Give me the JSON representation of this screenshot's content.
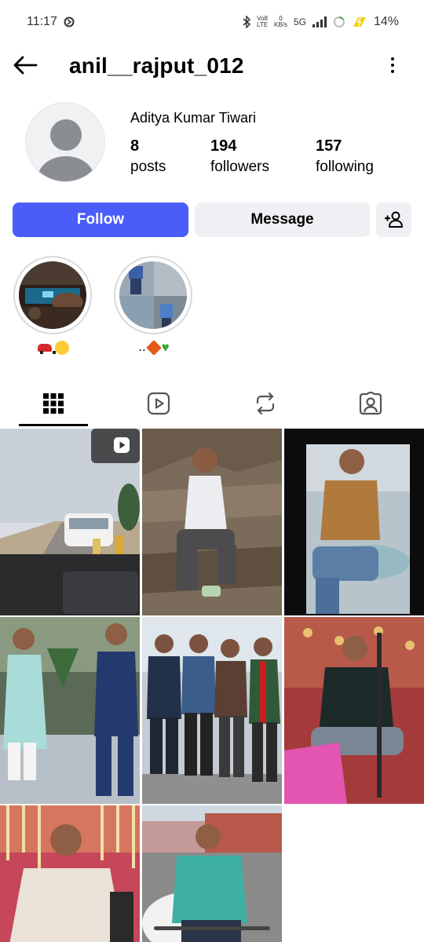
{
  "status_bar": {
    "time": "11:17",
    "network_top": "Vo8",
    "network_bottom": "LTE",
    "speed_top": "0",
    "speed_bottom": "KB/s",
    "network_type": "5G",
    "battery": "14%"
  },
  "header": {
    "username": "anil__rajput_012"
  },
  "profile": {
    "full_name": "Aditya Kumar Tiwari",
    "stats": [
      {
        "value": "8",
        "label": "posts"
      },
      {
        "value": "194",
        "label": "followers"
      },
      {
        "value": "157",
        "label": "following"
      }
    ]
  },
  "actions": {
    "follow_label": "Follow",
    "message_label": "Message"
  },
  "highlights": [
    {
      "label_prefix": ""
    },
    {
      "label_prefix": ".."
    }
  ],
  "tabs": [
    {
      "icon": "grid-icon",
      "selected": true
    },
    {
      "icon": "reels-icon",
      "selected": false
    },
    {
      "icon": "reposts-icon",
      "selected": false
    },
    {
      "icon": "tagged-icon",
      "selected": false
    }
  ],
  "colors": {
    "follow_button": "#4a5df9",
    "secondary_button": "#eff0f3"
  }
}
